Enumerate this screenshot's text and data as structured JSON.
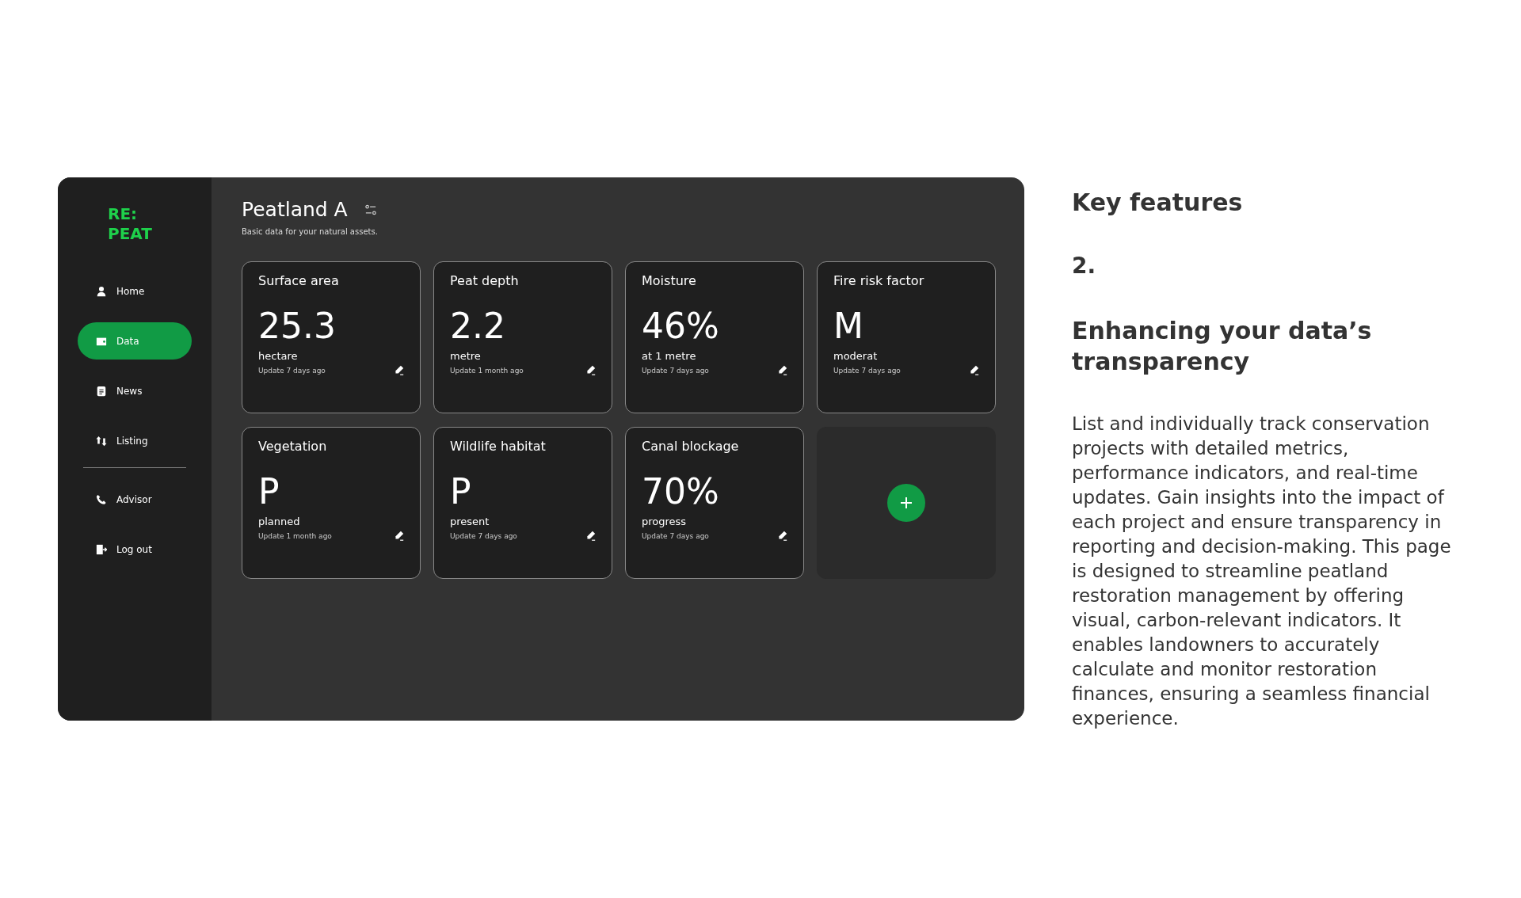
{
  "app": {
    "logo": [
      "RE:",
      "PEAT"
    ],
    "sidebar": {
      "items": [
        {
          "label": "Home",
          "selected": false
        },
        {
          "label": "Data",
          "selected": true
        },
        {
          "label": "News",
          "selected": false
        },
        {
          "label": "Listing",
          "selected": false
        }
      ],
      "bottom_items": [
        {
          "label": "Advisor",
          "selected": false
        },
        {
          "label": "Log out",
          "selected": false
        }
      ]
    },
    "title": "Peatland A",
    "subtitle": "Basic data for your natural assets.",
    "cards": [
      {
        "title": "Surface area",
        "value": "25.3",
        "unit": "hectare",
        "updated": "Update 7 days ago"
      },
      {
        "title": "Peat depth",
        "value": "2.2",
        "unit": "metre",
        "updated": "Update 1 month ago"
      },
      {
        "title": "Moisture",
        "value": "46%",
        "unit": "at 1 metre",
        "updated": "Update 7 days ago"
      },
      {
        "title": "Fire risk factor",
        "value": "M",
        "unit": "moderat",
        "updated": "Update 7 days ago"
      },
      {
        "title": "Vegetation",
        "value": "P",
        "unit": "planned",
        "updated": "Update 1 month ago"
      },
      {
        "title": "Wildlife habitat",
        "value": "P",
        "unit": "present",
        "updated": "Update 7 days ago"
      },
      {
        "title": "Canal blockage",
        "value": "70%",
        "unit": "progress",
        "updated": "Update 7 days ago"
      }
    ]
  },
  "description": {
    "eyebrow": "Key features",
    "number": "2.",
    "heading": "Enhancing your data’s transparency",
    "body": "List and individually track conservation projects with detailed metrics, performance indicators, and real-time updates. Gain insights into the impact of each project and ensure transparency in reporting and decision-making. This page is designed to streamline peatland restoration management by offering visual, carbon-relevant indicators. It enables landowners to accurately calculate and monitor restoration finances, ensuring a seamless financial experience."
  }
}
